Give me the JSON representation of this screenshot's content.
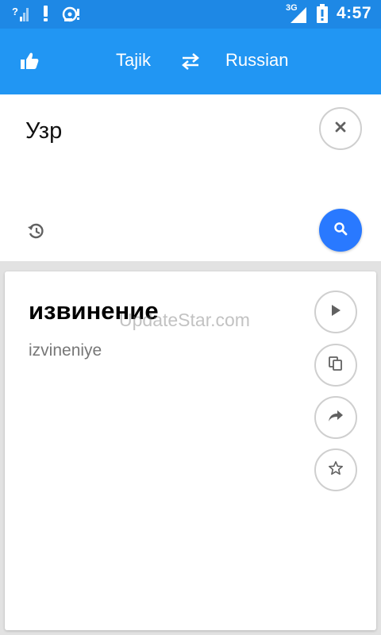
{
  "status_bar": {
    "time": "4:57",
    "network_type": "3G",
    "left_icons": [
      "wifi-question-icon",
      "alert-icon",
      "hdd-alert-icon"
    ],
    "right_icons": [
      "signal-icon",
      "battery-alert-icon"
    ]
  },
  "toolbar": {
    "source_language": "Tajik",
    "target_language": "Russian",
    "icons": [
      "thumbs-up-icon",
      "swap-icon"
    ]
  },
  "input": {
    "text": "Узр",
    "icons": [
      "close-icon",
      "history-icon",
      "search-icon"
    ]
  },
  "result": {
    "translation": "извинение",
    "transliteration": "izvineniye",
    "watermark": "UpdateStar.com",
    "actions": [
      "play-icon",
      "copy-icon",
      "share-icon",
      "star-icon"
    ]
  },
  "colors": {
    "status_bar": "#1e88e5",
    "toolbar": "#2196f3",
    "search_button": "#2979ff",
    "background": "#e2e2e2"
  }
}
